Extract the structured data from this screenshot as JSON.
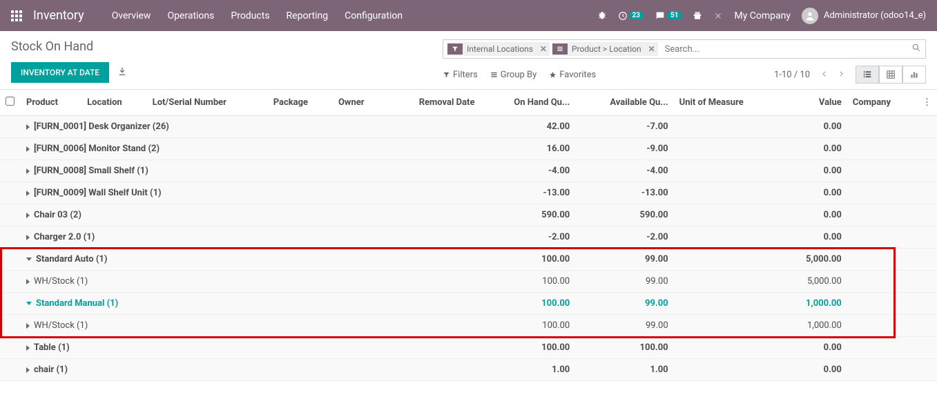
{
  "topnav": {
    "app_name": "Inventory",
    "links": [
      "Overview",
      "Operations",
      "Products",
      "Reporting",
      "Configuration"
    ],
    "debug_badge": "23",
    "msg_badge": "51",
    "company": "My Company",
    "user": "Administrator (odoo14_e)"
  },
  "control_panel": {
    "title": "Stock On Hand",
    "btn_inventory": "INVENTORY AT DATE",
    "facets": [
      {
        "label": "Internal Locations",
        "type": "filter"
      },
      {
        "label": "Product > Location",
        "type": "groupby"
      }
    ],
    "search_placeholder": "Search...",
    "filters_label": "Filters",
    "groupby_label": "Group By",
    "favorites_label": "Favorites",
    "pager": "1-10 / 10"
  },
  "columns": {
    "product": "Product",
    "location": "Location",
    "lot": "Lot/Serial Number",
    "package": "Package",
    "owner": "Owner",
    "removal": "Removal Date",
    "onhand": "On Hand Qu...",
    "available": "Available Qu...",
    "uom": "Unit of Measure",
    "value": "Value",
    "company": "Company"
  },
  "rows": [
    {
      "type": "group",
      "caret": "right",
      "label": "[FURN_0001] Desk Organizer (26)",
      "onhand": "42.00",
      "available": "-7.00",
      "value": "0.00"
    },
    {
      "type": "group",
      "caret": "right",
      "label": "[FURN_0006] Monitor Stand (2)",
      "onhand": "16.00",
      "available": "-9.00",
      "value": "0.00"
    },
    {
      "type": "group",
      "caret": "right",
      "label": "[FURN_0008] Small Shelf (1)",
      "onhand": "-4.00",
      "available": "-4.00",
      "value": "0.00"
    },
    {
      "type": "group",
      "caret": "right",
      "label": "[FURN_0009] Wall Shelf Unit (1)",
      "onhand": "-13.00",
      "available": "-13.00",
      "value": "0.00"
    },
    {
      "type": "group",
      "caret": "right",
      "label": "Chair 03 (2)",
      "onhand": "590.00",
      "available": "590.00",
      "value": "0.00"
    },
    {
      "type": "group",
      "caret": "right",
      "label": "Charger 2.0 (1)",
      "onhand": "-2.00",
      "available": "-2.00",
      "value": "0.00"
    },
    {
      "type": "group",
      "caret": "down",
      "label": "Standard Auto (1)",
      "onhand": "100.00",
      "available": "99.00",
      "value": "5,000.00",
      "highlight": true
    },
    {
      "type": "child",
      "caret": "right",
      "label": "WH/Stock (1)",
      "onhand": "100.00",
      "available": "99.00",
      "value": "5,000.00",
      "highlight": true
    },
    {
      "type": "group",
      "caret": "down",
      "label": "Standard Manual (1)",
      "onhand": "100.00",
      "available": "99.00",
      "value": "1,000.00",
      "teal": true,
      "highlight": true
    },
    {
      "type": "child",
      "caret": "right",
      "label": "WH/Stock (1)",
      "onhand": "100.00",
      "available": "99.00",
      "value": "1,000.00",
      "highlight": true
    },
    {
      "type": "group",
      "caret": "right",
      "label": "Table (1)",
      "onhand": "100.00",
      "available": "100.00",
      "value": "0.00"
    },
    {
      "type": "group",
      "caret": "right",
      "label": "chair (1)",
      "onhand": "1.00",
      "available": "1.00",
      "value": "0.00"
    }
  ],
  "chart_data": {
    "type": "table",
    "title": "Stock On Hand",
    "columns": [
      "Product",
      "On Hand Quantity",
      "Available Quantity",
      "Value"
    ],
    "rows": [
      [
        "[FURN_0001] Desk Organizer (26)",
        42.0,
        -7.0,
        0.0
      ],
      [
        "[FURN_0006] Monitor Stand (2)",
        16.0,
        -9.0,
        0.0
      ],
      [
        "[FURN_0008] Small Shelf (1)",
        -4.0,
        -4.0,
        0.0
      ],
      [
        "[FURN_0009] Wall Shelf Unit (1)",
        -13.0,
        -13.0,
        0.0
      ],
      [
        "Chair 03 (2)",
        590.0,
        590.0,
        0.0
      ],
      [
        "Charger 2.0 (1)",
        -2.0,
        -2.0,
        0.0
      ],
      [
        "Standard Auto (1)",
        100.0,
        99.0,
        5000.0
      ],
      [
        "Standard Manual (1)",
        100.0,
        99.0,
        1000.0
      ],
      [
        "Table (1)",
        100.0,
        100.0,
        0.0
      ],
      [
        "chair (1)",
        1.0,
        1.0,
        0.0
      ]
    ]
  }
}
